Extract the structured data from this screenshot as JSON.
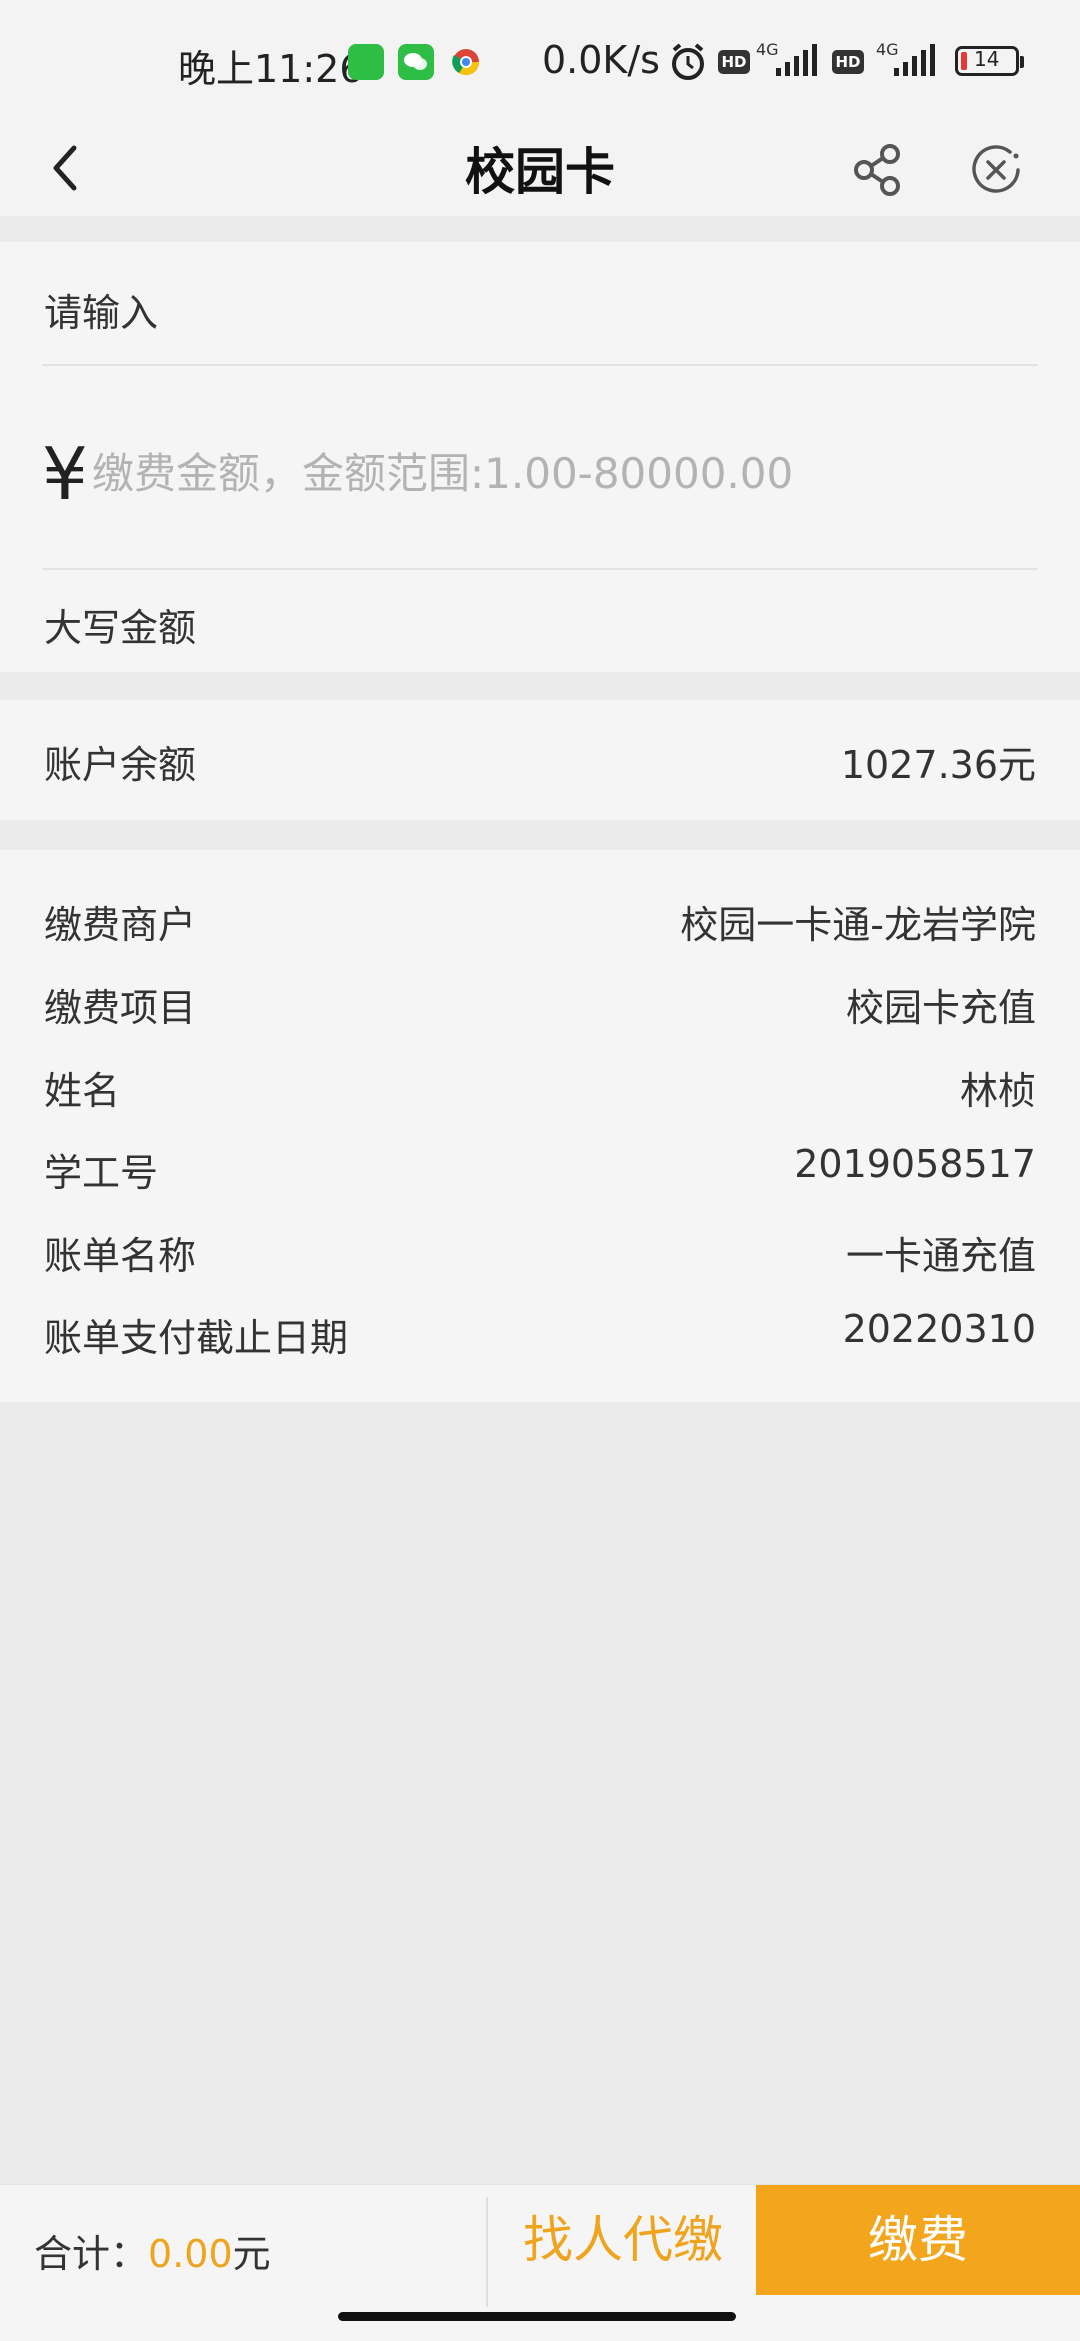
{
  "status_bar": {
    "time": "晚上11:26",
    "net_speed": "0.0K/s",
    "hd_label": "HD",
    "network_type": "4G",
    "battery": "14",
    "icons": [
      "sound-app-icon",
      "wechat-icon",
      "chrome-icon",
      "alarm-icon",
      "hd-icon",
      "signal-icon",
      "battery-icon"
    ]
  },
  "nav": {
    "title": "校园卡",
    "back_icon": "chevron-left-icon",
    "share_icon": "share-icon",
    "close_icon": "close-circle-icon"
  },
  "input_section": {
    "input_label": "请输入",
    "currency_symbol": "¥",
    "amount_placeholder": "缴费金额，金额范围:1.00-80000.00",
    "amount_value": "",
    "uppercase_label": "大写金额"
  },
  "balance": {
    "label": "账户余额",
    "value": "1027.36元"
  },
  "info_rows": [
    {
      "label": "缴费商户",
      "value": "校园一卡通-龙岩学院"
    },
    {
      "label": "缴费项目",
      "value": "校园卡充值"
    },
    {
      "label": "姓名",
      "value": "林桢"
    },
    {
      "label": "学工号",
      "value": "2019058517"
    },
    {
      "label": "账单名称",
      "value": "一卡通充值"
    },
    {
      "label": "账单支付截止日期",
      "value": "20220310"
    }
  ],
  "bottom_bar": {
    "total_label": "合计：",
    "total_amount": "0.00",
    "total_unit": "元",
    "proxy_pay_label": "找人代缴",
    "pay_label": "缴费"
  },
  "colors": {
    "accent": "#f3a51c",
    "background": "#ebebeb",
    "section": "#f5f5f5"
  }
}
